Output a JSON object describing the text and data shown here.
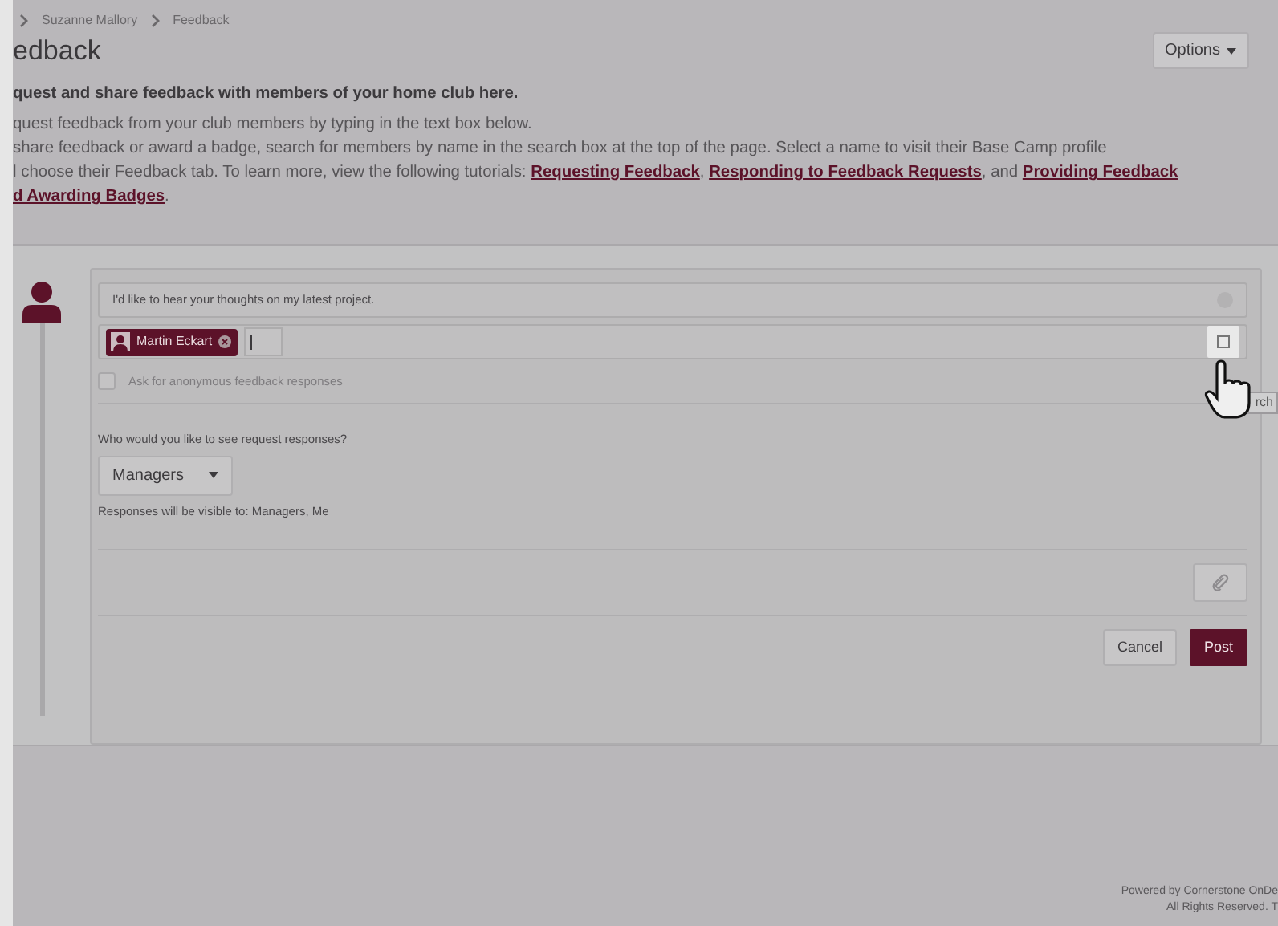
{
  "breadcrumb": [
    "Suzanne Mallory",
    "Feedback"
  ],
  "title": "edback",
  "options_button": "Options",
  "intro": {
    "heading": "quest and share feedback with members of your home club here.",
    "line": "quest feedback from your club members by typing in the text box below.",
    "paragraph": [
      [
        {
          "kind": "text",
          "text": "share feedback or award a badge, search for members by name in the search box at the top of the page. Select a name to visit their Base Camp profile"
        }
      ],
      [
        {
          "kind": "text",
          "text": "l choose their Feedback tab. To learn more, view the following tutorials: "
        },
        {
          "kind": "link",
          "text": "Requesting Feedback"
        },
        {
          "kind": "text",
          "text": ", "
        },
        {
          "kind": "link",
          "text": "Responding to Feedback Requests"
        },
        {
          "kind": "text",
          "text": ", and "
        },
        {
          "kind": "link",
          "text": "Providing Feedback"
        }
      ],
      [
        {
          "kind": "link",
          "text": "d Awarding Badges"
        },
        {
          "kind": "text",
          "text": "."
        }
      ]
    ]
  },
  "form": {
    "message": "I'd like to hear your thoughts on my latest project.",
    "recipients": [
      {
        "name": "Martin Eckart"
      }
    ],
    "anonymous": {
      "label": "Ask for anonymous feedback responses",
      "checked": false,
      "disabled": true
    },
    "visibility_question": "Who would you like to see request responses?",
    "visibility_select": "Managers",
    "visibility_note": "Responses will be visible to: Managers, Me",
    "cancel": "Cancel",
    "post": "Post"
  },
  "tooltip": "rch",
  "footer": [
    "Powered by Cornerstone OnDe",
    "All Rights Reserved. T"
  ]
}
